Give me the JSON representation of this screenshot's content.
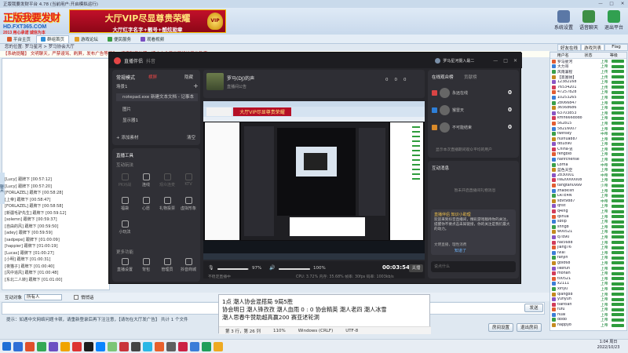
{
  "window": {
    "title": "正版我要发财平台 4.78 (当前用户:开启模拟运行)",
    "controls": [
      "—",
      "□",
      "✕"
    ]
  },
  "banner": {
    "logo_main": "正版我要发财",
    "logo_url": "HD.FXT365.COM",
    "logo_tagline": "2013 用心承诺  诚信为本",
    "vip_line1": "大厅VIP尽显尊贵荣耀",
    "vip_line2": "大厅红字名字+靓号+酷炫勋章",
    "vip_badge": "VIP",
    "buttons": [
      {
        "label": "系统设置",
        "color": "#5b78a6"
      },
      {
        "label": "语音聊天",
        "color": "#3d8f45"
      },
      {
        "label": "退出平台",
        "color": "#31a050"
      }
    ]
  },
  "nav": {
    "tabs": [
      {
        "label": "平台主页",
        "color": "#d95b2d",
        "active": false
      },
      {
        "label": "群组首页",
        "color": "#2f8fd6",
        "active": true
      },
      {
        "label": "游戏论坛",
        "color": "#e0a02a",
        "active": false
      },
      {
        "label": "便民服务",
        "color": "#3b9b44",
        "active": false
      },
      {
        "label": "观看视频",
        "color": "#7a4fc2",
        "active": false
      }
    ]
  },
  "right_tabs": [
    "好友在线",
    "游戏列表",
    "Flag"
  ],
  "address": "您的位置: 罗马星河 > 罗马协会大厅",
  "marquee": "【系统提醒】 文明聊天，严禁谩骂、刷屏，发布广告等行为，违者封号处理，请广大会员共同维护平台秩序。",
  "chat_lines": [
    "[Lucy] 跟牌下 [00:57:12]",
    "[Lucy] 跟牌下 [00:57:20]",
    "[FORLAZEL] 跟牌下 [00:58:28]",
    "[上帝] 跟牌下 [00:58:47]",
    "[FORLAZEL] 跟牌下 [00:58:58]",
    "[新疆毛驴先生] 跟牌下 [00:59:12]",
    "[solemn] 跟牌下 [00:59:37]",
    "[自由的风] 跟牌下 [00:59:50]",
    "[adey] 跟牌下 [00:59:59]",
    "[sadpepe] 跟牌下 [01:00:09]",
    "[happier] 跟牌下 [01:00:19]",
    "[Lucas] 跟牌下 [01:00:27]",
    "[小明] 跟牌下 [01:00:31]",
    "[夜猫子] 跟牌下 [01:00:40]",
    "[风中追风] 跟牌下 [01:00:48]",
    "[东北二人转] 跟牌下 [01:01:00]"
  ],
  "side_tab": "聊天",
  "talkbar": {
    "label": "互动对象",
    "target": "所有人",
    "checkbox": "悄悄话"
  },
  "tip": "提示：如遇中文网络问题卡顿，请重新登录后再下注注意，【请勿在大厅发广告】  共计 1 个文件",
  "buttons": {
    "send": "发送",
    "room_settings": "房间设置",
    "leave": "退出房间"
  },
  "user_list": {
    "headers": [
      "用户名",
      "状态",
      "等级"
    ],
    "rows": [
      [
        "罗马星河",
        "上帝"
      ],
      [
        "大力哥",
        "上帝"
      ],
      [
        "风雨兼程",
        "上传"
      ],
      [
        "【高富帅】",
        "上传"
      ],
      [
        "12382168",
        "上帝"
      ],
      [
        "76534201",
        "上传"
      ],
      [
        "47257828",
        "上帝"
      ],
      [
        "10253265",
        "上帝"
      ],
      [
        "28066847",
        "上帝"
      ],
      [
        "36568686",
        "上帝"
      ],
      [
        "63703853",
        "上帝"
      ],
      [
        "kmn666dodo",
        "上帝"
      ],
      [
        "562815",
        "上帝"
      ],
      [
        "58216007",
        "上帝"
      ],
      [
        "twinsky",
        "中帝"
      ],
      [
        "huihua887",
        "上帝"
      ],
      [
        "dd1890",
        "上帝"
      ],
      [
        "China-yj",
        "上帝"
      ],
      [
        "fengbl8",
        "上帝"
      ],
      [
        "hanfchense",
        "上帝"
      ],
      [
        "Lorna",
        "中帝"
      ],
      [
        "蓝色天空",
        "上帝"
      ],
      [
        "2830001",
        "中帝"
      ],
      [
        "lila20000008",
        "上帝"
      ],
      [
        "tangtan0999",
        "少帝"
      ],
      [
        "zhaokilin",
        "上帝"
      ],
      [
        "LRTE4N",
        "上帝"
      ],
      [
        "sdvt9887",
        "中帝"
      ],
      [
        "qhst",
        "上帝"
      ],
      [
        "q4ing",
        "上帝"
      ],
      [
        "qshua",
        "上帝"
      ],
      [
        "sbtlp",
        "上帝"
      ],
      [
        "shng8",
        "上帝"
      ],
      [
        "w00521",
        "上帝"
      ],
      [
        "q7890",
        "上帝"
      ],
      [
        "hai5688",
        "上帝"
      ],
      [
        "jiang76",
        "上帝"
      ],
      [
        "lvlai",
        "上帝"
      ],
      [
        "fanjin",
        "上帝"
      ],
      [
        "gold68",
        "上帝"
      ],
      [
        "likefun",
        "上帝"
      ],
      [
        "mohan",
        "上帝"
      ],
      [
        "t00521",
        "上帝"
      ],
      [
        "x2111",
        "上帝"
      ],
      [
        "xinyu",
        "上帝"
      ],
      [
        "qiang88",
        "上帝"
      ],
      [
        "yunyun",
        "上帝"
      ],
      [
        "tiantian",
        "上帝"
      ],
      [
        "fufu",
        "上帝"
      ],
      [
        "huai",
        "上帝"
      ],
      [
        "dodo",
        "上帝"
      ],
      [
        "happy8",
        "上帝"
      ]
    ]
  },
  "stream": {
    "app": "直播伴侣",
    "app_tag": "抖音",
    "account": "罗马星河摄入最二",
    "room_name": "罗马(DJ)的声",
    "room_sub": "直播间公告",
    "counters": [
      "0",
      "0",
      "0"
    ],
    "mode_label": "常规模式",
    "mode_badge": "横屏",
    "hide_label": "隐藏",
    "scene_label": "场景1",
    "sources": [
      "notepad.exe 新建文本文档 - 记事本",
      "图片",
      "显示器1"
    ],
    "add_source": "+ 添加素材",
    "clear": "清空",
    "tools_title": "直播工具",
    "interact_title": "互动玩法",
    "tools": [
      [
        "PK对战",
        true
      ],
      [
        "连线",
        false
      ],
      [
        "观众连麦",
        true
      ],
      [
        "KTV",
        true
      ],
      [
        "福袋",
        false
      ],
      [
        "心愿",
        false
      ],
      [
        "礼物投票",
        false
      ],
      [
        "虚拟形象",
        false
      ],
      [
        "小玩法",
        false
      ]
    ],
    "more_title": "更多功能",
    "more": [
      "直播设置",
      "背包",
      "管理员",
      "抖音商城"
    ],
    "volume_mic": "97%",
    "volume_sys": "100%",
    "timer": "00:03:54",
    "end_button": "关播",
    "stats": "CPU: 3.72%   内存: 35.68%   帧率: 30fps   码率: 1003kb/s",
    "warning": "不稳定直播中",
    "audience_title": "在线观众榜",
    "audience_tab": "贡献榜",
    "audience": [
      {
        "name": "永远在线",
        "score": "0",
        "color": "#d94444"
      },
      {
        "name": "猴雷天",
        "score": "0",
        "color": "#2e7fd8"
      },
      {
        "name": "不可能结束",
        "score": "0",
        "color": "#d98a2a"
      }
    ],
    "audience_hint": "显示本次直播期间观众平均的用户",
    "msg_title": "互动消息",
    "msg_hint": "暂未开启直播间礼物消息",
    "notice_title": "直播伴侣  知识小助理",
    "notice_text": "欢迎来到抖音直播间，精彩游戏稿待你的关注，提醒你不要点击未知链接，你的关注是我们最大的动力。",
    "notice_sub": "文明直播，理性消费",
    "notice_btn": "知道了",
    "chat_placeholder": "说点什么"
  },
  "notepad": {
    "lines": [
      "1点        潮人协会混搭局          9局5胜",
      "协会明日 潮人锋孜孜 潮人血雨 0 :  0 协会精英 潮人老四 潮人冰雪",
      "潮人思春牛赞助超高赢200     赛亚述轮洞"
    ],
    "status": [
      "第 3 行，第 26 列",
      "110%",
      "Windows (CRLF)",
      "UTF-8"
    ]
  },
  "taskbar": {
    "icons": [
      "#2f6fd6",
      "#e14f2a",
      "#34a853",
      "#6b4fc2",
      "#f0a400",
      "#d33",
      "#1d1d1d",
      "#0a84ff",
      "#7cc576",
      "#c9343b",
      "#444",
      "#2ab7e5",
      "#e8602c",
      "#5e5e5e",
      "#cc2244",
      "#3b7dd8",
      "#1f9e5a",
      "#eeaa22"
    ],
    "time": "1:04 周日",
    "date": "2022/10/23"
  }
}
